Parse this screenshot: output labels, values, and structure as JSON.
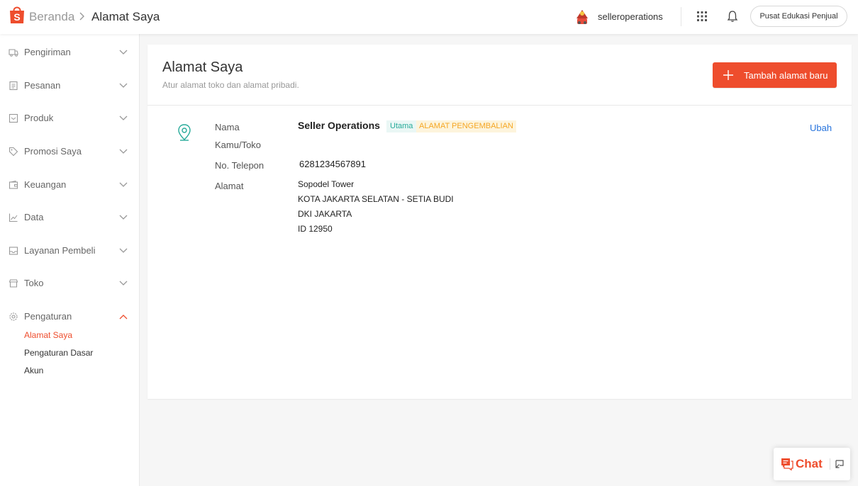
{
  "header": {
    "breadcrumb_home": "Beranda",
    "breadcrumb_current": "Alamat Saya",
    "username": "selleroperations",
    "edu_button": "Pusat Edukasi Penjual"
  },
  "sidebar": {
    "items": [
      {
        "label": "Pengiriman",
        "icon": "truck-icon"
      },
      {
        "label": "Pesanan",
        "icon": "clipboard-icon"
      },
      {
        "label": "Produk",
        "icon": "box-icon"
      },
      {
        "label": "Promosi Saya",
        "icon": "tag-icon"
      },
      {
        "label": "Keuangan",
        "icon": "wallet-icon"
      },
      {
        "label": "Data",
        "icon": "chart-icon"
      },
      {
        "label": "Layanan Pembeli",
        "icon": "inbox-icon"
      },
      {
        "label": "Toko",
        "icon": "store-icon"
      },
      {
        "label": "Pengaturan",
        "icon": "gear-icon"
      }
    ],
    "sub_items": [
      "Alamat Saya",
      "Pengaturan Dasar",
      "Akun"
    ]
  },
  "main": {
    "title": "Alamat Saya",
    "subtitle": "Atur alamat toko dan alamat pribadi.",
    "add_button": "Tambah alamat baru",
    "address": {
      "name_label_1": "Nama",
      "name_label_2": "Kamu/Toko",
      "name_value": "Seller Operations",
      "badge_primary": "Utama",
      "badge_return": "ALAMAT PENGEMBALIAN",
      "phone_label": "No. Telepon",
      "phone_value": "6281234567891",
      "address_label": "Alamat",
      "address_lines": [
        "Sopodel Tower",
        "KOTA JAKARTA SELATAN - SETIA BUDI",
        "DKI JAKARTA",
        "ID 12950"
      ],
      "edit_label": "Ubah"
    }
  },
  "chat": {
    "label": "Chat"
  },
  "colors": {
    "accent": "#ee4d2d",
    "link": "#2673dd",
    "teal": "#26aa99",
    "return_badge": "#f5a623"
  }
}
